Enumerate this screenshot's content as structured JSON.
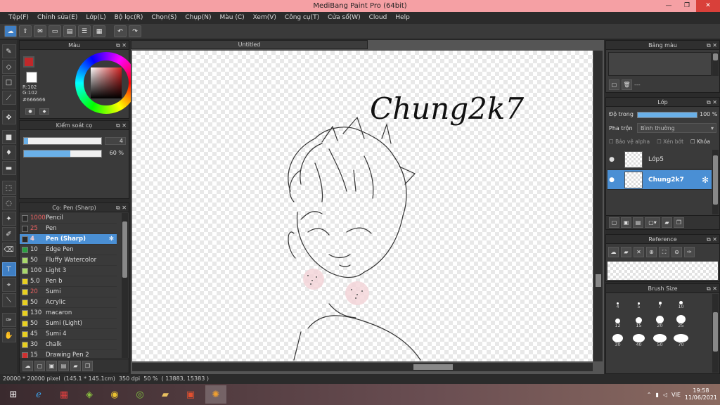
{
  "window": {
    "title": "MediBang Paint Pro (64bit)"
  },
  "menu": [
    "Tệp(F)",
    "Chỉnh sửa(E)",
    "Lớp(L)",
    "Bộ lọc(R)",
    "Chọn(S)",
    "Chụp(N)",
    "Màu (C)",
    "Xem(V)",
    "Công cụ(T)",
    "Cửa sổ(W)",
    "Cloud",
    "Help"
  ],
  "panels": {
    "color": {
      "title": "Màu",
      "r": "R:102",
      "g": "G:102",
      "hex": "#666666",
      "fg": "#c0282a",
      "bg": "#ffffff"
    },
    "brush_control": {
      "title": "Kiểm soát cọ",
      "size": "4",
      "opacity": "60 %",
      "size_frac": 0.05,
      "opacity_frac": 0.6
    },
    "brush_list": {
      "title": "Cọ: Pen (Sharp)",
      "items": [
        {
          "size": "1000",
          "name": "Pencil",
          "color": "#2a2a2a",
          "red": true
        },
        {
          "size": "25",
          "name": "Pen",
          "color": "#2a2a2a",
          "red": true
        },
        {
          "size": "4",
          "name": "Pen (Sharp)",
          "color": "#2a2a2a",
          "red": true,
          "selected": true
        },
        {
          "size": "10",
          "name": "Edge Pen",
          "color": "#2aa040"
        },
        {
          "size": "50",
          "name": "Fluffy Watercolor",
          "color": "#a8d86a"
        },
        {
          "size": "100",
          "name": "Light 3",
          "color": "#a8d86a"
        },
        {
          "size": "5.0",
          "name": " Pen b",
          "color": "#e8d020"
        },
        {
          "size": "20",
          "name": "Sumi",
          "color": "#e8d020",
          "red": true
        },
        {
          "size": "50",
          "name": "Acrylic",
          "color": "#e8d020"
        },
        {
          "size": "130",
          "name": "macaron",
          "color": "#e8d020"
        },
        {
          "size": "50",
          "name": "Sumi (Light)",
          "color": "#e8d020"
        },
        {
          "size": "45",
          "name": "Sumi 4",
          "color": "#e8d020"
        },
        {
          "size": "30",
          "name": "chalk",
          "color": "#e8d020"
        },
        {
          "size": "15",
          "name": "Drawing Pen 2",
          "color": "#d03030"
        }
      ]
    },
    "palette": {
      "title": "Bảng màu",
      "dashes": "---"
    },
    "layer": {
      "title": "Lớp",
      "opacity_label": "Độ trong",
      "opacity_value": "100 %",
      "blend_label": "Pha trộn",
      "blend_value": "Bình thường",
      "protect_alpha": "Bảo vệ alpha",
      "clip": "Xén bớt",
      "lock": "Khóa",
      "layers": [
        {
          "name": "Lớp5",
          "selected": false
        },
        {
          "name": "Chung2k7",
          "selected": true
        }
      ]
    },
    "reference": {
      "title": "Reference"
    },
    "brush_size": {
      "title": "Brush Size",
      "sizes": [
        "4",
        "5",
        "7",
        "10",
        "12",
        "15",
        "20",
        "25",
        "30",
        "40",
        "50",
        "70"
      ]
    }
  },
  "document": {
    "tab": "Untitled",
    "text": "Chung2k7"
  },
  "status": {
    "text": "20000 * 20000 pixel  (145.1 * 145.1cm)  350 dpi  50 %  ( 13883, 15383 )"
  },
  "taskbar": {
    "lang": "VIE",
    "time": "19:58",
    "date": "11/06/2021"
  }
}
